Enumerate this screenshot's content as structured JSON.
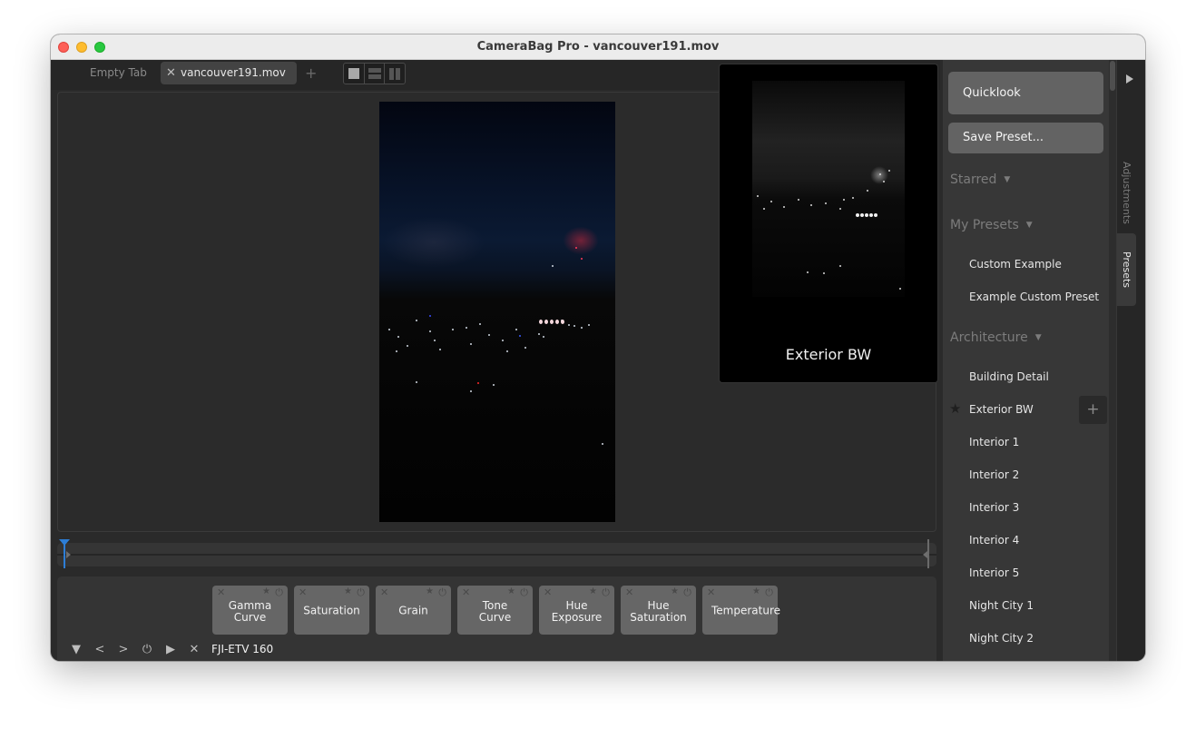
{
  "window": {
    "title": "CameraBag Pro - vancouver191.mov"
  },
  "tabs": {
    "items": [
      {
        "label": "Empty Tab",
        "active": false
      },
      {
        "label": "vancouver191.mov",
        "active": true
      }
    ],
    "close_icon": "✕",
    "add_icon": "+",
    "view_modes": [
      "single",
      "split-horizontal",
      "split-vertical"
    ]
  },
  "quicklook_preview": {
    "caption": "Exterior BW"
  },
  "timeline": {
    "playhead_position": 0
  },
  "adjustments": {
    "cards": [
      {
        "label": "Gamma Curve"
      },
      {
        "label": "Saturation"
      },
      {
        "label": "Grain"
      },
      {
        "label": "Tone Curve"
      },
      {
        "label": "Hue Exposure"
      },
      {
        "label": "Hue Saturation"
      },
      {
        "label": "Temperature"
      }
    ],
    "card_icons": {
      "remove": "✕",
      "pin": "📌",
      "power": "⏻"
    },
    "controls": {
      "collapse": "▼",
      "prev": "<",
      "next": ">",
      "power": "⏻",
      "play": "▶",
      "clear": "✕"
    },
    "preset_name": "FJI-ETV 160"
  },
  "sidebar": {
    "quicklook_label": "Quicklook",
    "save_preset_label": "Save Preset...",
    "sections": [
      {
        "title": "Starred",
        "items": []
      },
      {
        "title": "My Presets",
        "items": [
          "Custom Example",
          "Example Custom Preset"
        ]
      },
      {
        "title": "Architecture",
        "items": [
          "Building Detail",
          "Exterior BW",
          "Interior 1",
          "Interior 2",
          "Interior 3",
          "Interior 4",
          "Interior 5",
          "Night City 1",
          "Night City 2"
        ]
      }
    ],
    "hovered_item": "Exterior BW",
    "caret": "▼",
    "star_icon": "★",
    "add_icon": "+"
  },
  "vertical_tabs": {
    "expand_icon": "▶",
    "items": [
      {
        "label": "Adjustments",
        "active": false
      },
      {
        "label": "Presets",
        "active": true
      }
    ]
  },
  "colors": {
    "playhead": "#2d7ed6",
    "panel_bg": "#373737",
    "button_bg": "#636363"
  }
}
